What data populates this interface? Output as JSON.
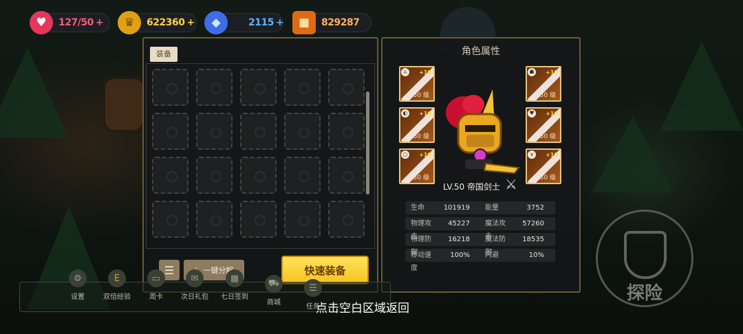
{
  "resources": [
    {
      "icon": "heart-icon",
      "value": "127/50",
      "plus": "+",
      "color": "#ff5a7a",
      "icon_bg": "#e8365a"
    },
    {
      "icon": "crown-coin-icon",
      "value": "622360",
      "plus": "+",
      "color": "#ffd23c",
      "icon_bg": "#e0a012"
    },
    {
      "icon": "diamond-icon",
      "value": "2115",
      "plus": "+",
      "color": "#5fb0ff",
      "icon_bg": "#3f6ce8"
    },
    {
      "icon": "ore-icon",
      "value": "829287",
      "plus": "",
      "color": "#ffb25a",
      "icon_bg": "#e06a12"
    }
  ],
  "inventory": {
    "tab_label": "装备",
    "decompose_label": "一键分解",
    "quick_equip_label": "快速装备"
  },
  "attributes": {
    "title": "角色属性",
    "hero_name": "LV.50 帝国剑士",
    "slots": [
      {
        "icon": "sword-icon",
        "plus": "+10",
        "level": "50 级"
      },
      {
        "icon": "helmet-icon",
        "plus": "+10",
        "level": "50 级"
      },
      {
        "icon": "shield-icon",
        "plus": "+10",
        "level": "50 级"
      },
      {
        "icon": "armor-icon",
        "plus": "+10",
        "level": "50 级"
      },
      {
        "icon": "ring-icon",
        "plus": "+10",
        "level": "50 级"
      },
      {
        "icon": "necklace-icon",
        "plus": "+10",
        "level": "50 级"
      }
    ],
    "stats": [
      {
        "n1": "生命",
        "v1": "101919",
        "n2": "能量",
        "v2": "3752"
      },
      {
        "n1": "物理攻击",
        "v1": "45227",
        "n2": "魔法攻击",
        "v2": "57260"
      },
      {
        "n1": "物理防御",
        "v1": "16218",
        "n2": "魔法防御",
        "v2": "18535"
      },
      {
        "n1": "移动速度",
        "v1": "100%",
        "n2": "闪避",
        "v2": "10%"
      }
    ]
  },
  "bottom_bar": [
    {
      "icon": "gear-icon",
      "label": "设置"
    },
    {
      "icon": "exp-icon",
      "label": "双倍经验"
    },
    {
      "icon": "card-icon",
      "label": "周卡"
    },
    {
      "icon": "gift-icon",
      "label": "次日礼包"
    },
    {
      "icon": "calendar-icon",
      "label": "七日签到"
    },
    {
      "icon": "cart-icon",
      "label": "商城"
    },
    {
      "icon": "task-icon",
      "label": "任务"
    }
  ],
  "back_hint": "点击空白区域返回",
  "explore_label": "探险"
}
